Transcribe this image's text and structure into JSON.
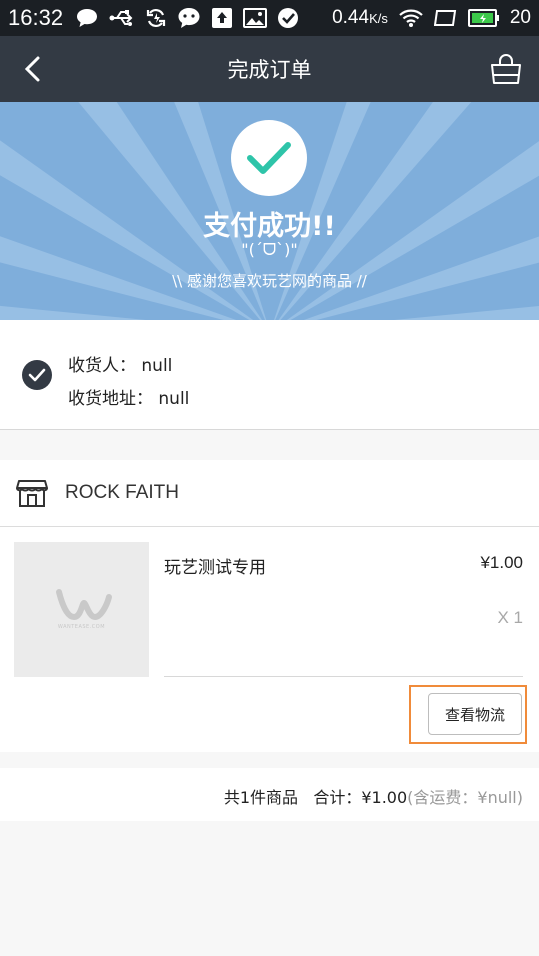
{
  "status_bar": {
    "time": "16:32",
    "network_speed": "0.44",
    "network_unit": "K/s",
    "battery_level": "20"
  },
  "nav": {
    "title": "完成订单"
  },
  "hero": {
    "title": "支付成功!!",
    "face": "\"(ˊᗜˋ)\"",
    "thanks": "\\\\ 感谢您喜欢玩艺网的商品 //",
    "colors": {
      "background": "#7faedb",
      "check": "#2ec4a9"
    }
  },
  "address": {
    "receiver_label": "收货人：",
    "receiver_value": "null",
    "address_label": "收货地址：",
    "address_value": "null"
  },
  "shop": {
    "name": "ROCK FAITH",
    "icon": "store-icon"
  },
  "product": {
    "name": "玩艺测试专用",
    "price": "¥1.00",
    "quantity": "X 1",
    "thumb_caption": "WANTEASE.COM"
  },
  "actions": {
    "logistics_label": "查看物流",
    "highlight_color": "#f08b3a"
  },
  "summary": {
    "count_text": "共1件商品",
    "total_label": "合计：",
    "total_value": "¥1.00",
    "shipping_open": "(含运费：",
    "shipping_value": "¥null",
    "shipping_close": ")"
  }
}
